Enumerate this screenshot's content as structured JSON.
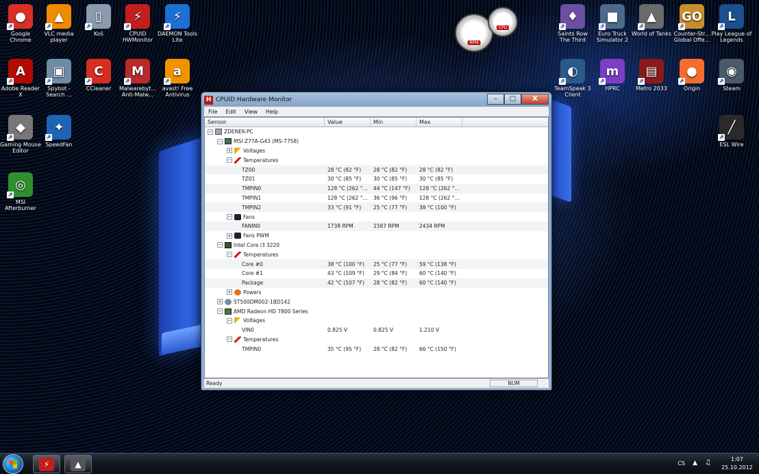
{
  "desktop": {
    "icons": [
      {
        "label": "Google Chrome",
        "glyph": "●",
        "color": "#d93025"
      },
      {
        "label": "VLC media player",
        "glyph": "▲",
        "color": "#f08a00"
      },
      {
        "label": "Koš",
        "glyph": "▯",
        "color": "#8a9bb0"
      },
      {
        "label": "CPUID HWMonitor",
        "glyph": "⚡",
        "color": "#c21e1e"
      },
      {
        "label": "DAEMON Tools Lite",
        "glyph": "⚡",
        "color": "#1d6fd6"
      },
      {
        "label": "Adobe Reader X",
        "glyph": "A",
        "color": "#b30b00"
      },
      {
        "label": "Spybot - Search ...",
        "glyph": "▣",
        "color": "#6f8ca6"
      },
      {
        "label": "CCleaner",
        "glyph": "C",
        "color": "#d62d20"
      },
      {
        "label": "Malwarebyt... Anti-Malw...",
        "glyph": "M",
        "color": "#bb2a2a"
      },
      {
        "label": "avast! Free Antivirus",
        "glyph": "a",
        "color": "#f39200"
      },
      {
        "label": "Gaming Mouse Editor",
        "glyph": "◆",
        "color": "#777777"
      },
      {
        "label": "SpeedFan",
        "glyph": "✦",
        "color": "#1e63b5"
      },
      {
        "label": "MSI Afterburner",
        "glyph": "◎",
        "color": "#2f8f2f"
      },
      {
        "label": "Saints Row The Third",
        "glyph": "♦",
        "color": "#6b4fa3"
      },
      {
        "label": "Euro Truck Simulator 2",
        "glyph": "■",
        "color": "#4c6a8a"
      },
      {
        "label": "World of Tanks",
        "glyph": "▲",
        "color": "#6a6a6a"
      },
      {
        "label": "Counter-Str... Global Offe...",
        "glyph": "GO",
        "color": "#c98f2a"
      },
      {
        "label": "Play League of Legends",
        "glyph": "L",
        "color": "#1b4f8f"
      },
      {
        "label": "TeamSpeak 3 Client",
        "glyph": "◐",
        "color": "#2a5a8a"
      },
      {
        "label": "HPRC",
        "glyph": "m",
        "color": "#7a3fc4"
      },
      {
        "label": "Metro 2033",
        "glyph": "▤",
        "color": "#8a1a1a"
      },
      {
        "label": "Origin",
        "glyph": "●",
        "color": "#f56c2d"
      },
      {
        "label": "Steam",
        "glyph": "◉",
        "color": "#4a5a6a"
      },
      {
        "label": "ESL Wire",
        "glyph": "╱",
        "color": "#2a2a2a"
      }
    ],
    "gadget_labels": [
      "RPM",
      "CPU"
    ]
  },
  "window": {
    "title": "CPUID Hardware Monitor",
    "min": "–",
    "max": "□",
    "close": "X",
    "menu": [
      "File",
      "Edit",
      "View",
      "Help"
    ],
    "columns": [
      "Sensor",
      "Value",
      "Min",
      "Max"
    ],
    "rows": [
      {
        "level": 0,
        "toggle": "−",
        "icon": "pc",
        "name": "ZDENEK-PC",
        "value": "",
        "min": "",
        "max": ""
      },
      {
        "level": 1,
        "toggle": "−",
        "icon": "mb",
        "name": "MSI Z77A-G43 (MS-7758)",
        "value": "",
        "min": "",
        "max": ""
      },
      {
        "level": 2,
        "toggle": "+",
        "icon": "volt",
        "name": "Voltages",
        "value": "",
        "min": "",
        "max": ""
      },
      {
        "level": 2,
        "toggle": "−",
        "icon": "temp",
        "name": "Temperatures",
        "value": "",
        "min": "",
        "max": ""
      },
      {
        "level": 3,
        "toggle": "",
        "icon": "",
        "name": "TZ00",
        "value": "28 °C (82 °F)",
        "min": "28 °C (82 °F)",
        "max": "28 °C (82 °F)"
      },
      {
        "level": 3,
        "toggle": "",
        "icon": "",
        "name": "TZ01",
        "value": "30 °C (85 °F)",
        "min": "30 °C (85 °F)",
        "max": "30 °C (85 °F)"
      },
      {
        "level": 3,
        "toggle": "",
        "icon": "",
        "name": "TMPIN0",
        "value": "128 °C (262 °...",
        "min": "44 °C (147 °F)",
        "max": "128 °C (262 °..."
      },
      {
        "level": 3,
        "toggle": "",
        "icon": "",
        "name": "TMPIN1",
        "value": "128 °C (262 °...",
        "min": "36 °C (96 °F)",
        "max": "128 °C (262 °..."
      },
      {
        "level": 3,
        "toggle": "",
        "icon": "",
        "name": "TMPIN2",
        "value": "33 °C (91 °F)",
        "min": "25 °C (77 °F)",
        "max": "38 °C (100 °F)"
      },
      {
        "level": 2,
        "toggle": "−",
        "icon": "fan",
        "name": "Fans",
        "value": "",
        "min": "",
        "max": ""
      },
      {
        "level": 3,
        "toggle": "",
        "icon": "",
        "name": "FANIN0",
        "value": "1738 RPM",
        "min": "1587 RPM",
        "max": "2434 RPM"
      },
      {
        "level": 2,
        "toggle": "+",
        "icon": "fan",
        "name": "Fans PWM",
        "value": "",
        "min": "",
        "max": ""
      },
      {
        "level": 1,
        "toggle": "−",
        "icon": "cpu",
        "name": "Intel Core i3 3220",
        "value": "",
        "min": "",
        "max": ""
      },
      {
        "level": 2,
        "toggle": "−",
        "icon": "temp",
        "name": "Temperatures",
        "value": "",
        "min": "",
        "max": ""
      },
      {
        "level": 3,
        "toggle": "",
        "icon": "",
        "name": "Core #0",
        "value": "38 °C (100 °F)",
        "min": "25 °C (77 °F)",
        "max": "59 °C (138 °F)"
      },
      {
        "level": 3,
        "toggle": "",
        "icon": "",
        "name": "Core #1",
        "value": "43 °C (109 °F)",
        "min": "29 °C (84 °F)",
        "max": "60 °C (140 °F)"
      },
      {
        "level": 3,
        "toggle": "",
        "icon": "",
        "name": "Package",
        "value": "42 °C (107 °F)",
        "min": "28 °C (82 °F)",
        "max": "60 °C (140 °F)"
      },
      {
        "level": 2,
        "toggle": "+",
        "icon": "pow",
        "name": "Powers",
        "value": "",
        "min": "",
        "max": ""
      },
      {
        "level": 1,
        "toggle": "+",
        "icon": "hdd",
        "name": "ST500DM002-1BD142",
        "value": "",
        "min": "",
        "max": ""
      },
      {
        "level": 1,
        "toggle": "−",
        "icon": "gpu",
        "name": "AMD Radeon HD 7800 Series",
        "value": "",
        "min": "",
        "max": ""
      },
      {
        "level": 2,
        "toggle": "−",
        "icon": "volt",
        "name": "Voltages",
        "value": "",
        "min": "",
        "max": ""
      },
      {
        "level": 3,
        "toggle": "",
        "icon": "",
        "name": "VIN0",
        "value": "0.825 V",
        "min": "0.825 V",
        "max": "1.210 V"
      },
      {
        "level": 2,
        "toggle": "−",
        "icon": "temp",
        "name": "Temperatures",
        "value": "",
        "min": "",
        "max": ""
      },
      {
        "level": 3,
        "toggle": "",
        "icon": "",
        "name": "TMPIN0",
        "value": "35 °C (95 °F)",
        "min": "28 °C (82 °F)",
        "max": "66 °C (150 °F)"
      }
    ],
    "status": "Ready",
    "num": "NUM"
  },
  "taskbar": {
    "apps": [
      {
        "name": "hwmonitor",
        "glyph": "⚡",
        "color": "#c21e1e"
      },
      {
        "name": "world-of-tanks",
        "glyph": "▲",
        "color": "#555555"
      }
    ],
    "lang": "CS",
    "time": "1:07",
    "date": "25.10.2012"
  }
}
